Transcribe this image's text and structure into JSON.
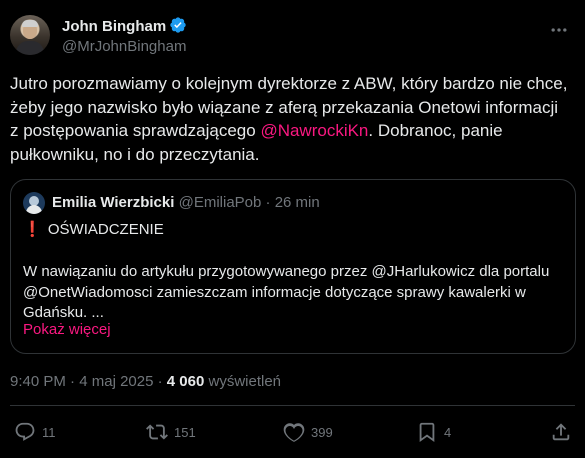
{
  "author": {
    "name": "John Bingham",
    "handle": "@MrJohnBingham"
  },
  "tweet": {
    "text_before": "Jutro porozmawiamy o kolejnym dyrektorze z ABW, który bardzo nie chce, żeby jego nazwisko było wiązane z aferą przekazania Onetowi informacji z postępowania sprawdzającego ",
    "mention": "@NawrockiKn",
    "text_after": ". Dobranoc, panie pułkowniku, no i do przeczytania."
  },
  "quote": {
    "name": "Emilia Wierzbicki",
    "handle": "@EmiliaPob",
    "separator": "·",
    "time": "26 min",
    "excl": "❗",
    "heading": "OŚWIADCZENIE",
    "body": "W nawiązaniu do artykułu przygotowywanego przez @JHarlukowicz dla portalu @OnetWiadomosci zamieszczam informacje dotyczące sprawy kawalerki w Gdańsku. ...",
    "show_more": "Pokaż więcej"
  },
  "meta": {
    "time": "9:40 PM",
    "separator1": "·",
    "date": "4 maj 2025",
    "separator2": "·",
    "views": "4 060",
    "views_label": "wyświetleń"
  },
  "actions": {
    "replies": "11",
    "retweets": "151",
    "likes": "399",
    "bookmarks": "4"
  },
  "colors": {
    "background": "#000000",
    "text": "#e7e9ea",
    "muted": "#71767b",
    "accent": "#f91880",
    "verified": "#1d9bf0",
    "border": "#2f3336"
  }
}
